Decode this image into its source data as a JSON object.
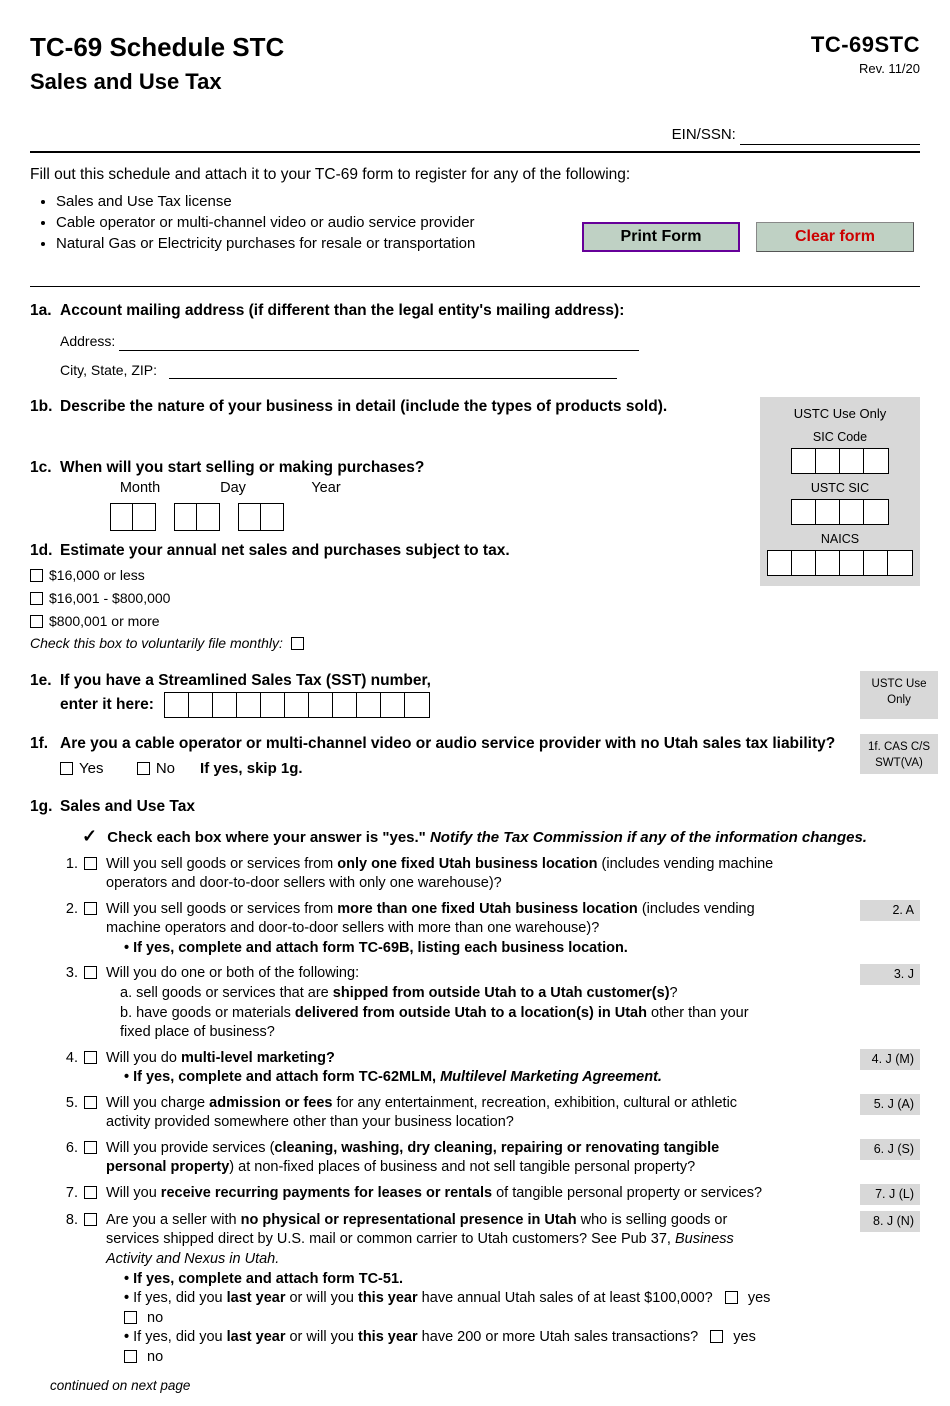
{
  "header": {
    "title": "TC-69 Schedule STC",
    "subtitle": "Sales and Use Tax",
    "form_code": "TC-69STC",
    "revision": "Rev. 11/20",
    "ein_label": "EIN/SSN:"
  },
  "intro": {
    "lead": "Fill out this schedule and attach it to your TC-69 form to register for any of the following:",
    "items": [
      "Sales and Use Tax license",
      "Cable operator or multi-channel video or audio service provider",
      "Natural Gas or Electricity purchases for resale or transportation"
    ]
  },
  "buttons": {
    "print": "Print Form",
    "clear": "Clear form"
  },
  "q1a": {
    "num": "1a.",
    "text": "Account mailing address (if different than the legal entity's mailing address):",
    "address_label": "Address:",
    "city_label": "City, State, ZIP:"
  },
  "q1b": {
    "num": "1b.",
    "text": "Describe the nature of your business in detail (include the types of products sold)."
  },
  "ustc_panel": {
    "title": "USTC Use Only",
    "sic_label": "SIC Code",
    "ustc_sic_label": "USTC SIC",
    "naics_label": "NAICS"
  },
  "q1c": {
    "num": "1c.",
    "text": "When will you start selling or making purchases?",
    "month": "Month",
    "day": "Day",
    "year": "Year"
  },
  "q1d": {
    "num": "1d.",
    "text": "Estimate your annual net sales and purchases subject to tax.",
    "opt1": "$16,000 or less",
    "opt2": "$16,001 - $800,000",
    "opt3": "$800,001 or more",
    "monthly": "Check this box to voluntarily file monthly:"
  },
  "q1e": {
    "num": "1e.",
    "line1": "If you have a Streamlined Sales Tax (SST) number,",
    "line2": "enter it here:"
  },
  "side1e": {
    "l1": "USTC Use",
    "l2": "Only"
  },
  "q1f": {
    "num": "1f.",
    "text_a": "Are you a cable operator or multi-channel video or audio service provider with no Utah sales tax liability?",
    "yes": "Yes",
    "no": "No",
    "skip": "If yes, skip 1g."
  },
  "side1f": {
    "l1": "1f. CAS C/S",
    "l2": "SWT(VA)"
  },
  "q1g": {
    "num": "1g.",
    "title": "Sales and Use Tax",
    "tip_a": "Check each box where your answer is \"yes.\" ",
    "tip_b": "Notify the Tax Commission if any of the information changes."
  },
  "g_items": [
    {
      "n": "1.",
      "side": "",
      "body": "Will you sell goods or services from <b>only one fixed Utah business location</b> (includes vending machine operators and door-to-door sellers with only one warehouse)?"
    },
    {
      "n": "2.",
      "side": "2. A",
      "body": "Will you sell goods or services from <b>more than one fixed Utah business location</b> (includes vending machine operators and door-to-door sellers with more than one warehouse)?",
      "bullets": [
        "<b>If yes, complete and attach form TC-69B, listing each business location.</b>"
      ]
    },
    {
      "n": "3.",
      "side": "3. J",
      "body": "Will you do one or both of the following:",
      "sublines": [
        "a. sell goods or services that are <b>shipped from outside Utah to a Utah customer(s)</b>?",
        "b. have goods or materials <b>delivered from outside Utah to a location(s) in Utah</b> other than your fixed place of business?"
      ]
    },
    {
      "n": "4.",
      "side": "4. J (M)",
      "body": "Will you do <b>multi-level marketing?</b>",
      "bullets": [
        "<b>If yes, complete and attach form TC-62MLM, <i>Multilevel Marketing Agreement.</i></b>"
      ]
    },
    {
      "n": "5.",
      "side": "5. J (A)",
      "body": "Will you charge <b>admission or fees</b> for any entertainment, recreation, exhibition, cultural or athletic activity provided somewhere other than your business location?"
    },
    {
      "n": "6.",
      "side": "6. J (S)",
      "body": "Will you provide services (<b>cleaning, washing, dry cleaning, repairing or renovating tangible personal property</b>) at non-fixed places of business and not sell tangible personal property?"
    },
    {
      "n": "7.",
      "side": "7. J (L)",
      "body": "Will you <b>receive recurring payments for leases or rentals</b> of tangible personal property or services?"
    },
    {
      "n": "8.",
      "side": "8. J (N)",
      "body": "Are you a seller with <b>no physical or representational presence in Utah</b> who is selling goods or services shipped direct by U.S. mail or common carrier to Utah customers? See Pub 37, <i>Business Activity and Nexus in Utah.</i>",
      "bullets": [
        "<b>If yes, complete and attach form TC-51.</b>"
      ],
      "yn_lines": [
        "If yes, did you <b>last year</b> or will you <b>this year</b> have annual Utah sales of at least $100,000?",
        "If yes, did you <b>last year</b> or will you <b>this year</b> have 200 or more Utah sales transactions?"
      ]
    }
  ],
  "yes_no": {
    "yes": "yes",
    "no": "no"
  },
  "continued": "continued on next page"
}
